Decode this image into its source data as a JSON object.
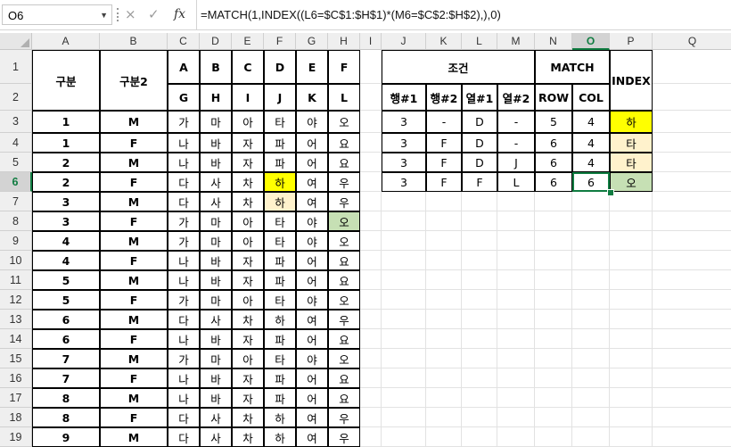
{
  "formula_bar": {
    "name_box": "O6",
    "cancel_icon": "×",
    "enter_icon": "✓",
    "fx_label": "fx",
    "formula": "=MATCH(1,INDEX((L6=$C$1:$H$1)*(M6=$C$2:$H$2),),0)"
  },
  "columns": [
    "A",
    "B",
    "C",
    "D",
    "E",
    "F",
    "G",
    "H",
    "I",
    "J",
    "K",
    "L",
    "M",
    "N",
    "O",
    "P",
    "Q"
  ],
  "selected_column": "O",
  "rows": [
    "1",
    "2",
    "3",
    "4",
    "5",
    "6",
    "7",
    "8",
    "9",
    "10",
    "11",
    "12",
    "13",
    "14",
    "15",
    "16",
    "17",
    "18",
    "19"
  ],
  "selected_row": "6",
  "left_table": {
    "header_a": "구분",
    "header_b": "구분2",
    "row1_headers": [
      "A",
      "B",
      "C",
      "D",
      "E",
      "F"
    ],
    "row2_headers": [
      "G",
      "H",
      "I",
      "J",
      "K",
      "L"
    ],
    "data": [
      [
        "1",
        "M",
        "가",
        "마",
        "아",
        "타",
        "야",
        "오"
      ],
      [
        "1",
        "F",
        "나",
        "바",
        "자",
        "파",
        "어",
        "요"
      ],
      [
        "2",
        "M",
        "나",
        "바",
        "자",
        "파",
        "어",
        "요"
      ],
      [
        "2",
        "F",
        "다",
        "사",
        "차",
        "하",
        "여",
        "우"
      ],
      [
        "3",
        "M",
        "다",
        "사",
        "차",
        "하",
        "여",
        "우"
      ],
      [
        "3",
        "F",
        "가",
        "마",
        "아",
        "타",
        "야",
        "오"
      ],
      [
        "4",
        "M",
        "가",
        "마",
        "아",
        "타",
        "야",
        "오"
      ],
      [
        "4",
        "F",
        "나",
        "바",
        "자",
        "파",
        "어",
        "요"
      ],
      [
        "5",
        "M",
        "나",
        "바",
        "자",
        "파",
        "어",
        "요"
      ],
      [
        "5",
        "F",
        "가",
        "마",
        "아",
        "타",
        "야",
        "오"
      ],
      [
        "6",
        "M",
        "다",
        "사",
        "차",
        "하",
        "여",
        "우"
      ],
      [
        "6",
        "F",
        "나",
        "바",
        "자",
        "파",
        "어",
        "요"
      ],
      [
        "7",
        "M",
        "가",
        "마",
        "아",
        "타",
        "야",
        "오"
      ],
      [
        "7",
        "F",
        "나",
        "바",
        "자",
        "파",
        "어",
        "요"
      ],
      [
        "8",
        "M",
        "나",
        "바",
        "자",
        "파",
        "어",
        "요"
      ],
      [
        "8",
        "F",
        "다",
        "사",
        "차",
        "하",
        "여",
        "우"
      ],
      [
        "9",
        "M",
        "다",
        "사",
        "차",
        "하",
        "여",
        "우"
      ]
    ]
  },
  "right_table": {
    "header_condition": "조건",
    "header_match": "MATCH",
    "header_index": "INDEX",
    "subheaders": [
      "행#1",
      "행#2",
      "열#1",
      "열#2",
      "ROW",
      "COL"
    ],
    "data": [
      [
        "3",
        "-",
        "D",
        "-",
        "5",
        "4",
        "하"
      ],
      [
        "3",
        "F",
        "D",
        "-",
        "6",
        "4",
        "타"
      ],
      [
        "3",
        "F",
        "D",
        "J",
        "6",
        "4",
        "타"
      ],
      [
        "3",
        "F",
        "F",
        "L",
        "6",
        "6",
        "오"
      ]
    ]
  },
  "colors": {
    "yellow": "#ffff00",
    "peach": "#fff2cc",
    "green": "#c6e0b4",
    "excel_green": "#107c41"
  }
}
